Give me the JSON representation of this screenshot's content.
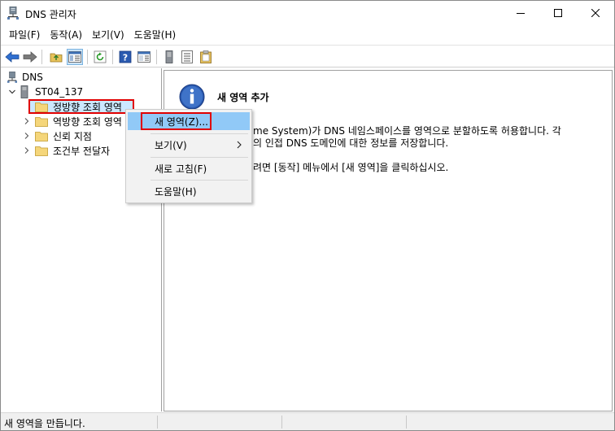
{
  "window": {
    "title": "DNS 관리자"
  },
  "menu": [
    "파일(F)",
    "동작(A)",
    "보기(V)",
    "도움말(H)"
  ],
  "toolbar_icons": [
    "back-arrow-icon",
    "forward-arrow-icon",
    "up-folder-icon",
    "show-hide-tree-icon",
    "refresh-icon",
    "help-icon",
    "properties-icon",
    "server-icon",
    "list-icon",
    "clipboard-icon"
  ],
  "tree": {
    "root": "DNS",
    "server": "ST04_137",
    "items": [
      "정방향 조회 영역",
      "역방향 조회 영역",
      "신뢰 지점",
      "조건부 전달자"
    ]
  },
  "right_pane": {
    "title": "새 영역 추가",
    "line1": "me System)가 DNS 네임스페이스를 영역으로 분할하도록 허용합니다. 각",
    "line2": "의 인접 DNS 도메인에 대한 정보를 저장합니다.",
    "line3": "려면 [동작] 메뉴에서 [새 영역]을 클릭하십시오."
  },
  "context_menu": {
    "new_zone": "새 영역(Z)...",
    "view": "보기(V)",
    "refresh": "새로 고침(F)",
    "help": "도움말(H)"
  },
  "status": {
    "text": "새 영역을 만듭니다."
  }
}
